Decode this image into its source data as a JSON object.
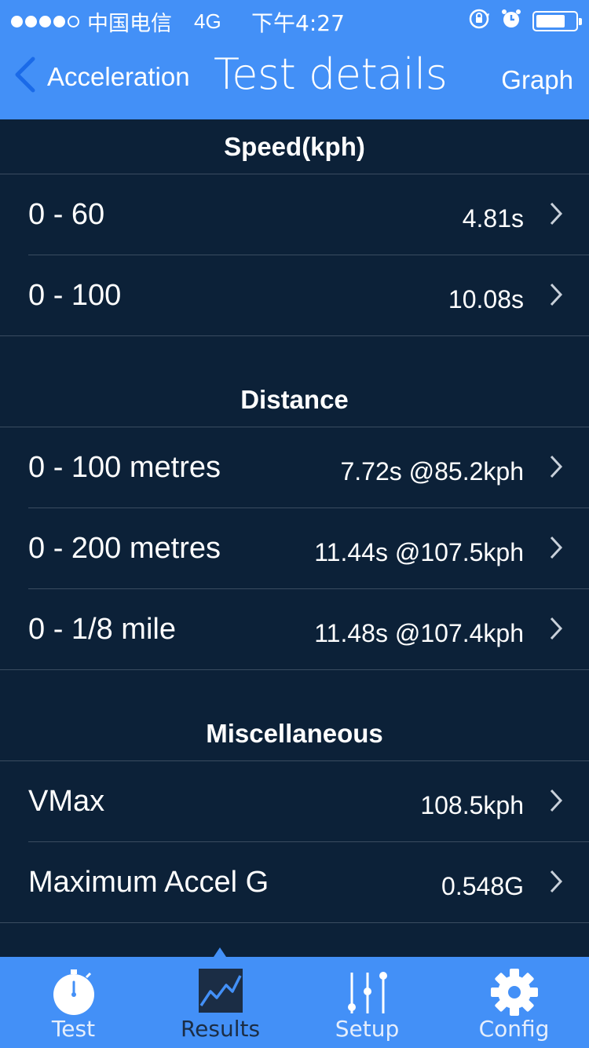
{
  "status_bar": {
    "carrier": "中国电信",
    "network": "4G",
    "time": "下午4:27"
  },
  "nav": {
    "back_label": "Acceleration",
    "title": "Test details",
    "right_label": "Graph"
  },
  "sections": {
    "speed": {
      "title": "Speed(kph)",
      "rows": [
        {
          "label": "0 - 60",
          "value": "4.81s"
        },
        {
          "label": "0 - 100",
          "value": "10.08s"
        }
      ]
    },
    "distance": {
      "title": "Distance",
      "rows": [
        {
          "label": "0 - 100 metres",
          "value": "7.72s @85.2kph"
        },
        {
          "label": "0 - 200 metres",
          "value": "11.44s @107.5kph"
        },
        {
          "label": "0 - 1/8 mile",
          "value": "11.48s @107.4kph"
        }
      ]
    },
    "misc": {
      "title": "Miscellaneous",
      "rows": [
        {
          "label": "VMax",
          "value": "108.5kph"
        },
        {
          "label": "Maximum Accel G",
          "value": "0.548G"
        }
      ]
    }
  },
  "tabbar": {
    "tabs": [
      {
        "label": "Test",
        "icon": "stopwatch-icon"
      },
      {
        "label": "Results",
        "icon": "chart-icon"
      },
      {
        "label": "Setup",
        "icon": "sliders-icon"
      },
      {
        "label": "Config",
        "icon": "gear-icon"
      }
    ],
    "active": "Results"
  },
  "colors": {
    "header": "#4390f7",
    "background": "#0c2138",
    "separator": "#3a4c60"
  }
}
